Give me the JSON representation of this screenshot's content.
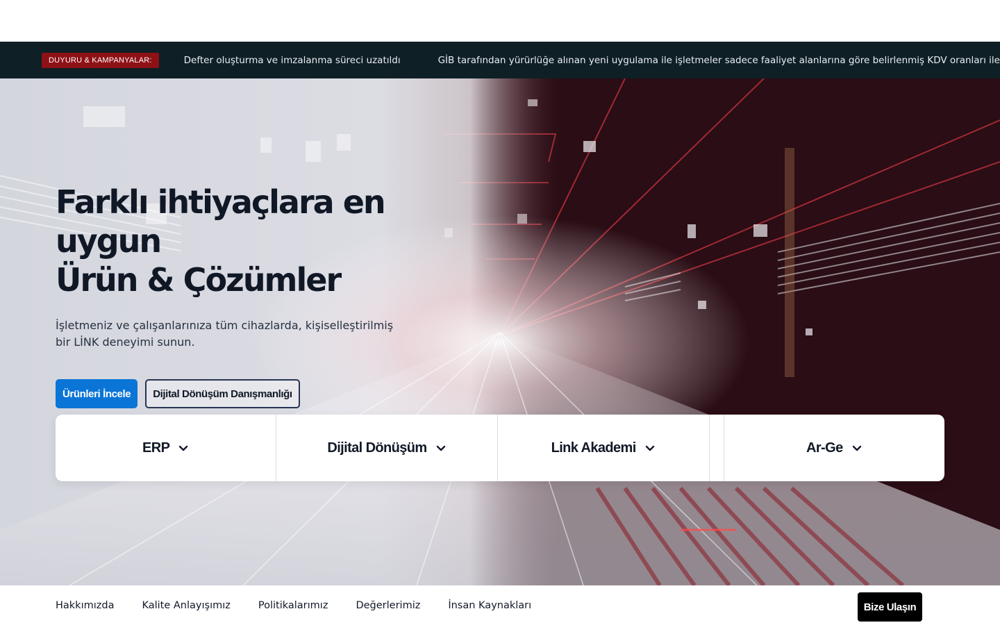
{
  "ticker": {
    "badge": "DUYURU & KAMPANYALAR:",
    "items": [
      "Defter oluşturma ve imzalanma süreci uzatıldı",
      "GİB tarafından yürürlüğe alınan yeni uygulama ile işletmeler sadece faaliyet alanlarına göre belirlenmiş KDV oranları ile"
    ]
  },
  "hero": {
    "title_line1": "Farklı ihtiyaçlara en uygun",
    "title_line2": "Ürün & Çözümler",
    "subtitle": "İşletmeniz ve çalışanlarınıza tüm cihazlarda, kişiselleştirilmiş bir LİNK deneyimi sunun.",
    "primary_button": "Ürünleri İncele",
    "secondary_button": "Dijital Dönüşüm Danışmanlığı"
  },
  "categories": [
    {
      "label": "ERP",
      "icon": "chevron-down-icon"
    },
    {
      "label": "Dijital Dönüşüm",
      "icon": "chevron-down-icon"
    },
    {
      "label": "Link Akademi",
      "icon": "chevron-down-icon"
    },
    {
      "label": "Ar-Ge",
      "icon": "chevron-down-icon"
    }
  ],
  "bottom_nav": {
    "links": [
      "Hakkımızda",
      "Kalite Anlayışımız",
      "Politikalarımız",
      "Değerlerimiz",
      "İnsan Kaynakları"
    ],
    "contact_button": "Bize Ulaşın"
  },
  "colors": {
    "ticker_bg": "#0f1f26",
    "badge_bg": "#8e1116",
    "primary": "#0a75d6",
    "accent_red": "#e5323a"
  }
}
